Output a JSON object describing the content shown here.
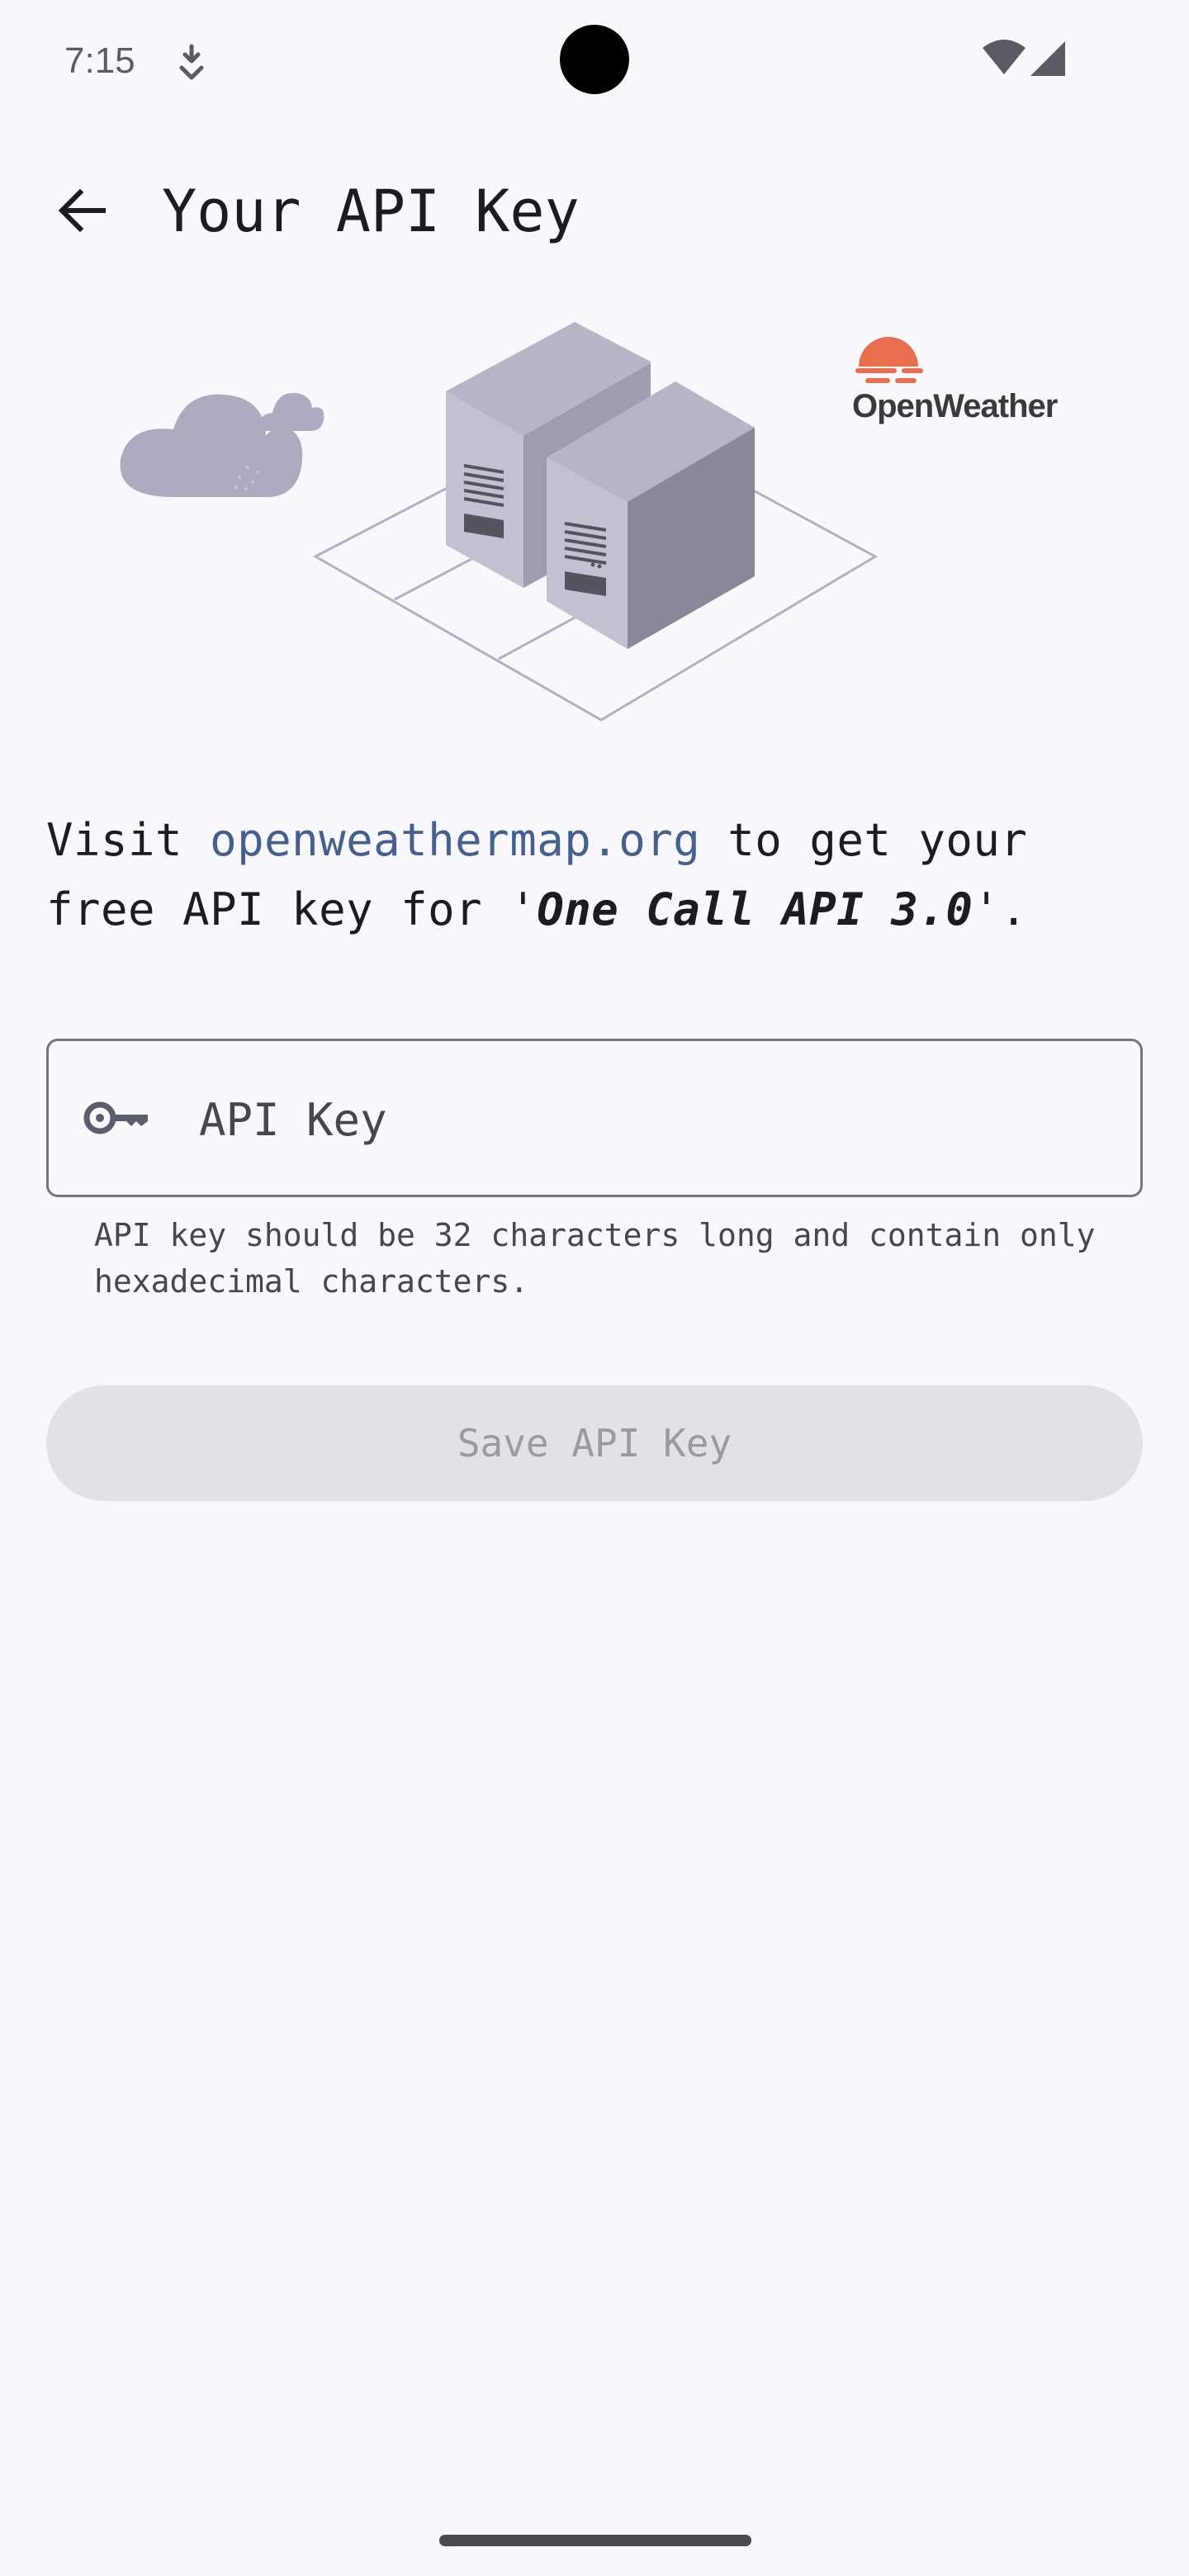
{
  "status_bar": {
    "time": "7:15",
    "icons": [
      "download-icon",
      "wifi-icon",
      "cell-signal-icon"
    ]
  },
  "app_bar": {
    "back_icon": "arrow-back-icon",
    "title": "Your API Key"
  },
  "illustration": {
    "logo_text": "OpenWeather",
    "logo_color": "#e96e50"
  },
  "description": {
    "prefix": "Visit ",
    "link": "openweathermap.org",
    "middle": " to get your free API key for '",
    "emphasis": "One Call API 3.0",
    "suffix": "'."
  },
  "api_key_field": {
    "icon": "key-icon",
    "placeholder": "API Key",
    "value": "",
    "helper": "API key should be 32 characters long and contain only hexadecimal characters."
  },
  "save_button": {
    "label": "Save API Key",
    "enabled": false
  },
  "colors": {
    "background": "#f7f7fc",
    "link": "#45608f",
    "button_disabled_bg": "#e2e2e6",
    "button_disabled_text": "#9a9aa0"
  }
}
